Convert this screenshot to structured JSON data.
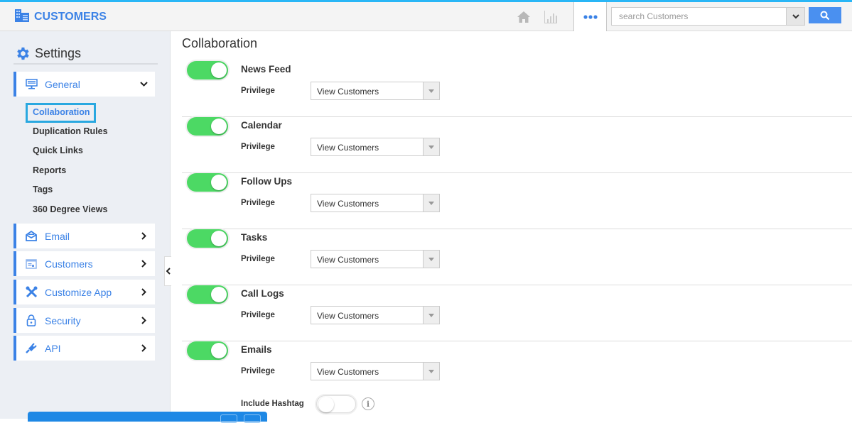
{
  "header": {
    "app_title": "CUSTOMERS",
    "brand_icon": "building-icon",
    "nav_icons": [
      "home-icon",
      "bar-chart-icon",
      "more-dots-icon"
    ],
    "search": {
      "placeholder": "search Customers",
      "value": "",
      "dropdown_icon": "chevron-down-icon",
      "button_icon": "search-icon"
    },
    "colors": {
      "accent": "#3b82e6",
      "top_strip": "#29b6f6",
      "search_button": "#4a90f0"
    }
  },
  "sidebar": {
    "title": "Settings",
    "title_icon": "gear-icon",
    "menu": [
      {
        "label": "General",
        "icon": "monitor-icon",
        "expanded": true,
        "sub_items": [
          {
            "label": "Collaboration",
            "active": true
          },
          {
            "label": "Duplication Rules",
            "active": false
          },
          {
            "label": "Quick Links",
            "active": false
          },
          {
            "label": "Reports",
            "active": false
          },
          {
            "label": "Tags",
            "active": false
          },
          {
            "label": "360 Degree Views",
            "active": false
          }
        ]
      },
      {
        "label": "Email",
        "icon": "envelope-open-icon",
        "expanded": false
      },
      {
        "label": "Customers",
        "icon": "window-icon",
        "expanded": false
      },
      {
        "label": "Customize App",
        "icon": "tools-icon",
        "expanded": false
      },
      {
        "label": "Security",
        "icon": "lock-icon",
        "expanded": false
      },
      {
        "label": "API",
        "icon": "plug-icon",
        "expanded": false
      }
    ]
  },
  "main": {
    "title": "Collaboration",
    "privilege_label": "Privilege",
    "sections": [
      {
        "title": "News Feed",
        "enabled": true,
        "privilege": "View Customers"
      },
      {
        "title": "Calendar",
        "enabled": true,
        "privilege": "View Customers"
      },
      {
        "title": "Follow Ups",
        "enabled": true,
        "privilege": "View Customers"
      },
      {
        "title": "Tasks",
        "enabled": true,
        "privilege": "View Customers"
      },
      {
        "title": "Call Logs",
        "enabled": true,
        "privilege": "View Customers"
      },
      {
        "title": "Emails",
        "enabled": true,
        "privilege": "View Customers"
      }
    ],
    "include_hashtag": {
      "label": "Include Hashtag",
      "enabled": false,
      "info_icon": "i"
    },
    "colors": {
      "toggle_on": "#4cd964"
    }
  }
}
